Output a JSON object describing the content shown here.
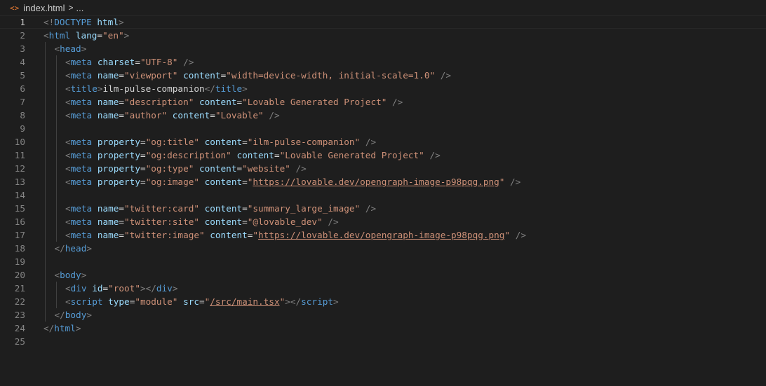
{
  "breadcrumb": {
    "icon": "code-file-icon",
    "icon_glyph": "<>",
    "file": "index.html",
    "separator": ">",
    "more": "..."
  },
  "active_line": 1,
  "colors": {
    "background": "#1e1e1e",
    "tag": "#569cd6",
    "attribute": "#9cdcfe",
    "string": "#ce9178",
    "punctuation": "#808080",
    "text": "#d4d4d4"
  },
  "lines": [
    {
      "n": "1",
      "indent": 0,
      "tokens": [
        [
          "p",
          "<!"
        ],
        [
          "g",
          "DOCTYPE"
        ],
        [
          "t",
          " "
        ],
        [
          "a",
          "html"
        ],
        [
          "p",
          ">"
        ]
      ]
    },
    {
      "n": "2",
      "indent": 0,
      "tokens": [
        [
          "p",
          "<"
        ],
        [
          "g",
          "html"
        ],
        [
          "t",
          " "
        ],
        [
          "a",
          "lang"
        ],
        [
          "e",
          "="
        ],
        [
          "s",
          "\"en\""
        ],
        [
          "p",
          ">"
        ]
      ]
    },
    {
      "n": "3",
      "indent": 1,
      "tokens": [
        [
          "p",
          "<"
        ],
        [
          "g",
          "head"
        ],
        [
          "p",
          ">"
        ]
      ]
    },
    {
      "n": "4",
      "indent": 2,
      "tokens": [
        [
          "p",
          "<"
        ],
        [
          "g",
          "meta"
        ],
        [
          "t",
          " "
        ],
        [
          "a",
          "charset"
        ],
        [
          "e",
          "="
        ],
        [
          "s",
          "\"UTF-8\""
        ],
        [
          "t",
          " "
        ],
        [
          "p",
          "/>"
        ]
      ]
    },
    {
      "n": "5",
      "indent": 2,
      "tokens": [
        [
          "p",
          "<"
        ],
        [
          "g",
          "meta"
        ],
        [
          "t",
          " "
        ],
        [
          "a",
          "name"
        ],
        [
          "e",
          "="
        ],
        [
          "s",
          "\"viewport\""
        ],
        [
          "t",
          " "
        ],
        [
          "a",
          "content"
        ],
        [
          "e",
          "="
        ],
        [
          "s",
          "\"width=device-width, initial-scale=1.0\""
        ],
        [
          "t",
          " "
        ],
        [
          "p",
          "/>"
        ]
      ]
    },
    {
      "n": "6",
      "indent": 2,
      "tokens": [
        [
          "p",
          "<"
        ],
        [
          "g",
          "title"
        ],
        [
          "p",
          ">"
        ],
        [
          "t",
          "ilm-pulse-companion"
        ],
        [
          "p",
          "</"
        ],
        [
          "g",
          "title"
        ],
        [
          "p",
          ">"
        ]
      ]
    },
    {
      "n": "7",
      "indent": 2,
      "tokens": [
        [
          "p",
          "<"
        ],
        [
          "g",
          "meta"
        ],
        [
          "t",
          " "
        ],
        [
          "a",
          "name"
        ],
        [
          "e",
          "="
        ],
        [
          "s",
          "\"description\""
        ],
        [
          "t",
          " "
        ],
        [
          "a",
          "content"
        ],
        [
          "e",
          "="
        ],
        [
          "s",
          "\"Lovable Generated Project\""
        ],
        [
          "t",
          " "
        ],
        [
          "p",
          "/>"
        ]
      ]
    },
    {
      "n": "8",
      "indent": 2,
      "tokens": [
        [
          "p",
          "<"
        ],
        [
          "g",
          "meta"
        ],
        [
          "t",
          " "
        ],
        [
          "a",
          "name"
        ],
        [
          "e",
          "="
        ],
        [
          "s",
          "\"author\""
        ],
        [
          "t",
          " "
        ],
        [
          "a",
          "content"
        ],
        [
          "e",
          "="
        ],
        [
          "s",
          "\"Lovable\""
        ],
        [
          "t",
          " "
        ],
        [
          "p",
          "/>"
        ]
      ]
    },
    {
      "n": "9",
      "indent": 2,
      "tokens": []
    },
    {
      "n": "10",
      "indent": 2,
      "tokens": [
        [
          "p",
          "<"
        ],
        [
          "g",
          "meta"
        ],
        [
          "t",
          " "
        ],
        [
          "a",
          "property"
        ],
        [
          "e",
          "="
        ],
        [
          "s",
          "\"og:title\""
        ],
        [
          "t",
          " "
        ],
        [
          "a",
          "content"
        ],
        [
          "e",
          "="
        ],
        [
          "s",
          "\"ilm-pulse-companion\""
        ],
        [
          "t",
          " "
        ],
        [
          "p",
          "/>"
        ]
      ]
    },
    {
      "n": "11",
      "indent": 2,
      "tokens": [
        [
          "p",
          "<"
        ],
        [
          "g",
          "meta"
        ],
        [
          "t",
          " "
        ],
        [
          "a",
          "property"
        ],
        [
          "e",
          "="
        ],
        [
          "s",
          "\"og:description\""
        ],
        [
          "t",
          " "
        ],
        [
          "a",
          "content"
        ],
        [
          "e",
          "="
        ],
        [
          "s",
          "\"Lovable Generated Project\""
        ],
        [
          "t",
          " "
        ],
        [
          "p",
          "/>"
        ]
      ]
    },
    {
      "n": "12",
      "indent": 2,
      "tokens": [
        [
          "p",
          "<"
        ],
        [
          "g",
          "meta"
        ],
        [
          "t",
          " "
        ],
        [
          "a",
          "property"
        ],
        [
          "e",
          "="
        ],
        [
          "s",
          "\"og:type\""
        ],
        [
          "t",
          " "
        ],
        [
          "a",
          "content"
        ],
        [
          "e",
          "="
        ],
        [
          "s",
          "\"website\""
        ],
        [
          "t",
          " "
        ],
        [
          "p",
          "/>"
        ]
      ]
    },
    {
      "n": "13",
      "indent": 2,
      "tokens": [
        [
          "p",
          "<"
        ],
        [
          "g",
          "meta"
        ],
        [
          "t",
          " "
        ],
        [
          "a",
          "property"
        ],
        [
          "e",
          "="
        ],
        [
          "s",
          "\"og:image\""
        ],
        [
          "t",
          " "
        ],
        [
          "a",
          "content"
        ],
        [
          "e",
          "="
        ],
        [
          "s",
          "\""
        ],
        [
          "l",
          "https://lovable.dev/opengraph-image-p98pqg.png"
        ],
        [
          "s",
          "\""
        ],
        [
          "t",
          " "
        ],
        [
          "p",
          "/>"
        ]
      ]
    },
    {
      "n": "14",
      "indent": 2,
      "tokens": []
    },
    {
      "n": "15",
      "indent": 2,
      "tokens": [
        [
          "p",
          "<"
        ],
        [
          "g",
          "meta"
        ],
        [
          "t",
          " "
        ],
        [
          "a",
          "name"
        ],
        [
          "e",
          "="
        ],
        [
          "s",
          "\"twitter:card\""
        ],
        [
          "t",
          " "
        ],
        [
          "a",
          "content"
        ],
        [
          "e",
          "="
        ],
        [
          "s",
          "\"summary_large_image\""
        ],
        [
          "t",
          " "
        ],
        [
          "p",
          "/>"
        ]
      ]
    },
    {
      "n": "16",
      "indent": 2,
      "tokens": [
        [
          "p",
          "<"
        ],
        [
          "g",
          "meta"
        ],
        [
          "t",
          " "
        ],
        [
          "a",
          "name"
        ],
        [
          "e",
          "="
        ],
        [
          "s",
          "\"twitter:site\""
        ],
        [
          "t",
          " "
        ],
        [
          "a",
          "content"
        ],
        [
          "e",
          "="
        ],
        [
          "s",
          "\"@lovable_dev\""
        ],
        [
          "t",
          " "
        ],
        [
          "p",
          "/>"
        ]
      ]
    },
    {
      "n": "17",
      "indent": 2,
      "tokens": [
        [
          "p",
          "<"
        ],
        [
          "g",
          "meta"
        ],
        [
          "t",
          " "
        ],
        [
          "a",
          "name"
        ],
        [
          "e",
          "="
        ],
        [
          "s",
          "\"twitter:image\""
        ],
        [
          "t",
          " "
        ],
        [
          "a",
          "content"
        ],
        [
          "e",
          "="
        ],
        [
          "s",
          "\""
        ],
        [
          "l",
          "https://lovable.dev/opengraph-image-p98pqg.png"
        ],
        [
          "s",
          "\""
        ],
        [
          "t",
          " "
        ],
        [
          "p",
          "/>"
        ]
      ]
    },
    {
      "n": "18",
      "indent": 1,
      "tokens": [
        [
          "p",
          "</"
        ],
        [
          "g",
          "head"
        ],
        [
          "p",
          ">"
        ]
      ]
    },
    {
      "n": "19",
      "indent": 1,
      "tokens": []
    },
    {
      "n": "20",
      "indent": 1,
      "tokens": [
        [
          "p",
          "<"
        ],
        [
          "g",
          "body"
        ],
        [
          "p",
          ">"
        ]
      ]
    },
    {
      "n": "21",
      "indent": 2,
      "tokens": [
        [
          "p",
          "<"
        ],
        [
          "g",
          "div"
        ],
        [
          "t",
          " "
        ],
        [
          "a",
          "id"
        ],
        [
          "e",
          "="
        ],
        [
          "s",
          "\"root\""
        ],
        [
          "p",
          "></"
        ],
        [
          "g",
          "div"
        ],
        [
          "p",
          ">"
        ]
      ]
    },
    {
      "n": "22",
      "indent": 2,
      "tokens": [
        [
          "p",
          "<"
        ],
        [
          "g",
          "script"
        ],
        [
          "t",
          " "
        ],
        [
          "a",
          "type"
        ],
        [
          "e",
          "="
        ],
        [
          "s",
          "\"module\""
        ],
        [
          "t",
          " "
        ],
        [
          "a",
          "src"
        ],
        [
          "e",
          "="
        ],
        [
          "s",
          "\""
        ],
        [
          "l",
          "/src/main.tsx"
        ],
        [
          "s",
          "\""
        ],
        [
          "p",
          "></"
        ],
        [
          "g",
          "script"
        ],
        [
          "p",
          ">"
        ]
      ]
    },
    {
      "n": "23",
      "indent": 1,
      "tokens": [
        [
          "p",
          "</"
        ],
        [
          "g",
          "body"
        ],
        [
          "p",
          ">"
        ]
      ]
    },
    {
      "n": "24",
      "indent": 0,
      "tokens": [
        [
          "p",
          "</"
        ],
        [
          "g",
          "html"
        ],
        [
          "p",
          ">"
        ]
      ]
    },
    {
      "n": "25",
      "indent": 0,
      "tokens": []
    }
  ]
}
